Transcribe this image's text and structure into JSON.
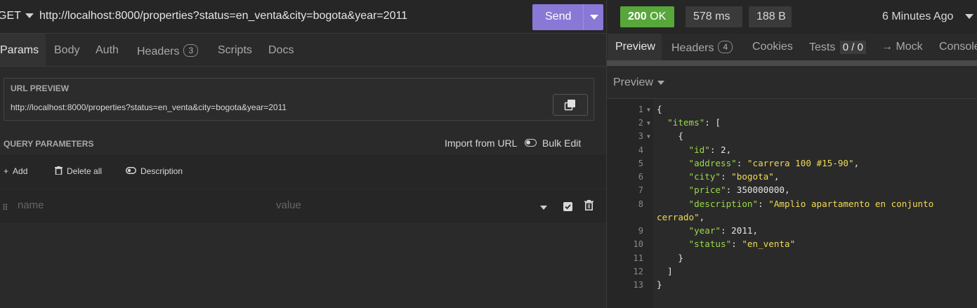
{
  "request": {
    "method": "GET",
    "url": "http://localhost:8000/properties?status=en_venta&city=bogota&year=2011",
    "send_label": "Send"
  },
  "request_tabs": {
    "params": "Params",
    "body": "Body",
    "auth": "Auth",
    "headers": "Headers",
    "headers_count": "3",
    "scripts": "Scripts",
    "docs": "Docs"
  },
  "url_preview": {
    "title": "URL PREVIEW",
    "url": "http://localhost:8000/properties?status=en_venta&city=bogota&year=2011"
  },
  "query_params": {
    "title": "QUERY PARAMETERS",
    "import_label": "Import from URL",
    "bulk_edit_label": "Bulk Edit",
    "add_label": "Add",
    "delete_all_label": "Delete all",
    "description_label": "Description",
    "name_placeholder": "name",
    "value_placeholder": "value"
  },
  "response": {
    "status_code": "200",
    "status_text": "OK",
    "time": "578 ms",
    "size": "188 B",
    "time_ago": "6 Minutes Ago",
    "status_color": "#57a73a"
  },
  "response_tabs": {
    "preview": "Preview",
    "headers": "Headers",
    "headers_count": "4",
    "cookies": "Cookies",
    "tests": "Tests",
    "tests_score": "0 / 0",
    "mock": "→ Mock",
    "console": "Console"
  },
  "preview_mode": "Preview",
  "code": {
    "line_numbers": [
      "1",
      "2",
      "3",
      "4",
      "5",
      "6",
      "7",
      "8",
      "9",
      "10",
      "11",
      "12",
      "13"
    ],
    "lines": {
      "l1": "{",
      "l2_key": "\"items\"",
      "l2_rest": ": [",
      "l3": "{",
      "l4_key": "\"id\"",
      "l4_val": "2",
      "l5_key": "\"address\"",
      "l5_val": "\"carrera 100 #15-90\"",
      "l6_key": "\"city\"",
      "l6_val": "\"bogota\"",
      "l7_key": "\"price\"",
      "l7_val": "350000000",
      "l8_key": "\"description\"",
      "l8_val": "\"Amplio apartamento en conjunto",
      "l8_wrap": "cerrado\"",
      "l9_key": "\"year\"",
      "l9_val": "2011",
      "l10_key": "\"status\"",
      "l10_val": "\"en_venta\"",
      "l11": "}",
      "l12": "]",
      "l13": "}"
    }
  },
  "colors": {
    "accent": "#8a78d6",
    "json_key": "#9bd84a",
    "json_string": "#f0da55"
  }
}
